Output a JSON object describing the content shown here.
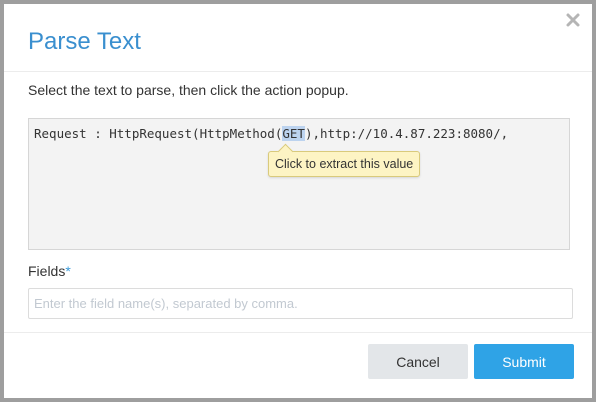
{
  "dialog": {
    "title": "Parse Text",
    "instruction": "Select the text to parse, then click the action popup.",
    "close_icon": "close-icon"
  },
  "parse_area": {
    "text_before": "Request : HttpRequest(HttpMethod(",
    "selected_text": "GET",
    "text_after": "),http://10.4.87.223:8080/,",
    "tooltip": "Click to extract this value"
  },
  "fields": {
    "label": "Fields",
    "required_marker": "*",
    "value": "",
    "placeholder": "Enter the field name(s), separated by comma."
  },
  "buttons": {
    "cancel": "Cancel",
    "submit": "Submit"
  },
  "colors": {
    "title": "#3a8fcf",
    "submit": "#2fa3e6",
    "cancel": "#e3e6e9",
    "selection": "#bcd3ef",
    "tooltip_bg": "#fdf4c4"
  }
}
